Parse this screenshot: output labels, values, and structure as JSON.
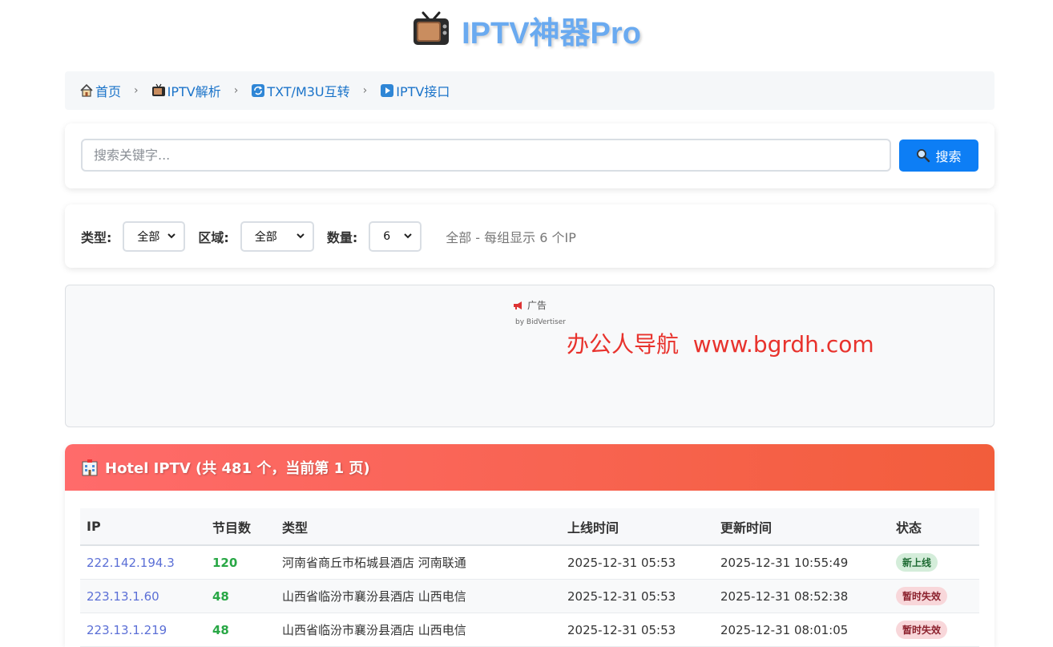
{
  "header": {
    "title": "IPTV神器Pro",
    "icon": "tv-icon"
  },
  "breadcrumb": [
    {
      "label": "首页",
      "icon": "home-icon"
    },
    {
      "label": "IPTV解析",
      "icon": "tv-icon"
    },
    {
      "label": "TXT/M3U互转",
      "icon": "refresh-icon"
    },
    {
      "label": "IPTV接口",
      "icon": "play-icon"
    }
  ],
  "breadcrumb_separator": "›",
  "search": {
    "placeholder": "搜索关键字...",
    "button_label": "搜索",
    "value": ""
  },
  "filters": {
    "type_label": "类型:",
    "type_value": "全部",
    "region_label": "区域:",
    "region_value": "全部",
    "count_label": "数量:",
    "count_value": "6",
    "info": "全部 - 每组显示 6 个IP"
  },
  "ad": {
    "label": "广告",
    "by": "by BidVertiser",
    "text": "办公人导航  www.bgrdh.com"
  },
  "panel": {
    "title": "Hotel IPTV (共 481 个，当前第 1 页)",
    "gradient_colors": [
      "#ff6b6b",
      "#f25d3b"
    ],
    "columns": [
      "IP",
      "节目数",
      "类型",
      "上线时间",
      "更新时间",
      "状态"
    ],
    "rows": [
      {
        "ip": "222.142.194.3",
        "count": "120",
        "type": "河南省商丘市柘城县酒店 河南联通",
        "online": "2025-12-31 05:53",
        "updated": "2025-12-31 10:55:49",
        "status": "新上线",
        "status_kind": "new"
      },
      {
        "ip": "223.13.1.60",
        "count": "48",
        "type": "山西省临汾市襄汾县酒店 山西电信",
        "online": "2025-12-31 05:53",
        "updated": "2025-12-31 08:52:38",
        "status": "暂时失效",
        "status_kind": "fail"
      },
      {
        "ip": "223.13.1.219",
        "count": "48",
        "type": "山西省临汾市襄汾县酒店 山西电信",
        "online": "2025-12-31 05:53",
        "updated": "2025-12-31 08:01:05",
        "status": "暂时失效",
        "status_kind": "fail"
      }
    ]
  },
  "colors": {
    "accent": "#0d7ef5",
    "title": "#6aaaf0",
    "link": "#1a73c9",
    "ip": "#5b6fd6",
    "count": "#28a745"
  }
}
